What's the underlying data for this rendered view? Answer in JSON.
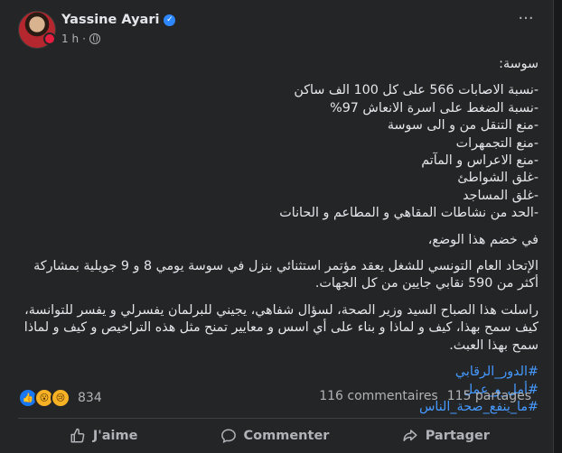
{
  "post": {
    "author": "Yassine Ayari",
    "time": "1 h",
    "separator": "·",
    "more_glyph": "···",
    "paragraphs": [
      "سوسة:",
      "-نسبة الاصابات 566 على كل 100 الف ساكن",
      "-نسبة الضغط على اسرة الانعاش 97%",
      "-منع التنقل من و الى سوسة",
      "-منع التجمهرات",
      "-منع الاعراس و المآتم",
      "-غلق الشواطئ",
      "-غلق المساجد",
      "-الحد من نشاطات المقاهي و المطاعم و الحانات",
      "في خضم هذا الوضع،",
      "الإتحاد العام التونسي للشغل يعقد مؤتمر استثنائي  بنزل في سوسة يومي 8 و 9 جويلية بمشاركة أكثر من 590 نقابي جايين من كل الجهات.",
      "راسلت هذا الصباح السيد وزير الصحة، لسؤال شفاهي، يجيني للبرلمان يفسرلي و يفسر للتوانسة، كيف سمح  بهذا، كيف و لماذا و بناء على أي اسس و معايير تمنح مثل هذه التراخيص و كيف و لماذا سمح بهذا العبث."
    ],
    "hashtags": [
      "#الدور_الرقابي",
      "#أمل_و_عمل",
      "#ما_ينفع_صحة_الناس"
    ]
  },
  "stats": {
    "reactions_count": "834",
    "comments": "116 commentaires",
    "shares": "115 partages"
  },
  "actions": {
    "like": "J'aime",
    "comment": "Commenter",
    "share": "Partager"
  },
  "icons": [
    "verified-icon",
    "globe-icon",
    "more-icon",
    "like-reaction-icon",
    "wow-reaction-icon",
    "sad-reaction-icon",
    "thumbs-up-icon",
    "comment-icon",
    "share-icon"
  ],
  "colors": {
    "background": "#242526",
    "text": "#e4e6eb",
    "muted": "#b0b3b8",
    "hashtag": "#4599ff",
    "verified": "#2d88ff"
  }
}
